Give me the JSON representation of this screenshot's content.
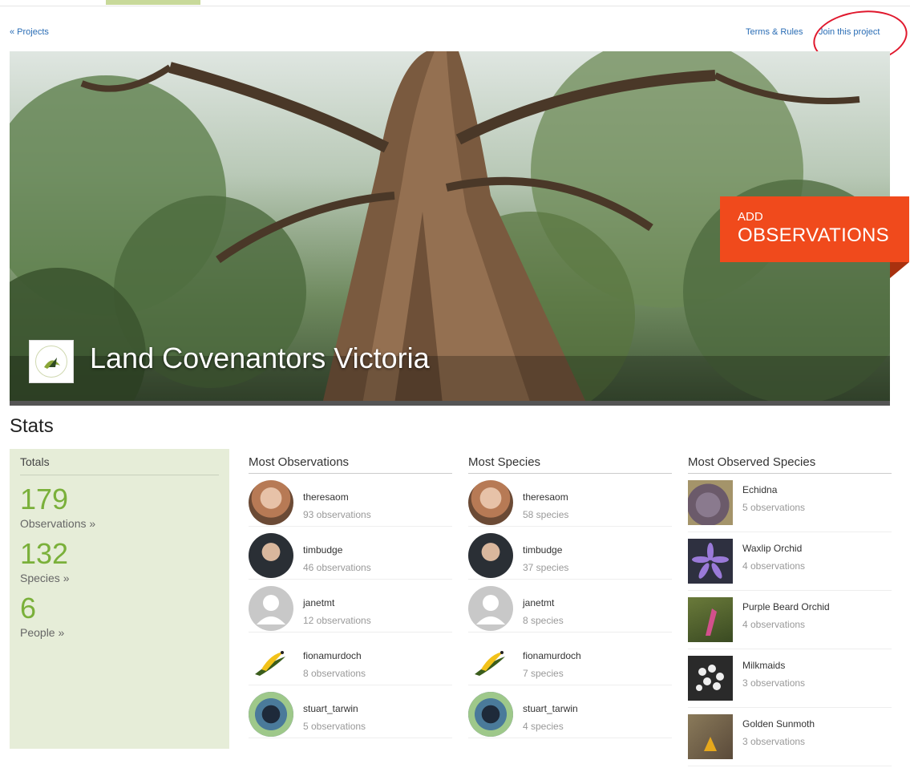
{
  "nav": {
    "back_link": "« Projects",
    "terms_link": "Terms & Rules",
    "join_link": "Join this project"
  },
  "hero": {
    "title": "Land Covenantors Victoria",
    "add_observations": {
      "line1": "ADD",
      "line2": "OBSERVATIONS"
    }
  },
  "stats": {
    "heading": "Stats",
    "totals": {
      "header": "Totals",
      "items": [
        {
          "value": "179",
          "label": "Observations »"
        },
        {
          "value": "132",
          "label": "Species »"
        },
        {
          "value": "6",
          "label": "People »"
        }
      ]
    },
    "most_observations": {
      "header": "Most Observations",
      "rows": [
        {
          "user": "theresaom",
          "meta": "93 observations",
          "avatar": "photo-woman"
        },
        {
          "user": "timbudge",
          "meta": "46 observations",
          "avatar": "photo-man"
        },
        {
          "user": "janetmt",
          "meta": "12 observations",
          "avatar": "default-user"
        },
        {
          "user": "fionamurdoch",
          "meta": "8 observations",
          "avatar": "bird"
        },
        {
          "user": "stuart_tarwin",
          "meta": "5 observations",
          "avatar": "circle-pattern"
        }
      ]
    },
    "most_species": {
      "header": "Most Species",
      "rows": [
        {
          "user": "theresaom",
          "meta": "58 species",
          "avatar": "photo-woman"
        },
        {
          "user": "timbudge",
          "meta": "37 species",
          "avatar": "photo-man"
        },
        {
          "user": "janetmt",
          "meta": "8 species",
          "avatar": "default-user"
        },
        {
          "user": "fionamurdoch",
          "meta": "7 species",
          "avatar": "bird"
        },
        {
          "user": "stuart_tarwin",
          "meta": "4 species",
          "avatar": "circle-pattern"
        }
      ]
    },
    "most_observed_species": {
      "header": "Most Observed Species",
      "rows": [
        {
          "name": "Echidna",
          "meta": "5 observations",
          "color": "#6b5a6a"
        },
        {
          "name": "Waxlip Orchid",
          "meta": "4 observations",
          "color": "#4a4a66"
        },
        {
          "name": "Purple Beard Orchid",
          "meta": "4 observations",
          "color": "#7a6a3a"
        },
        {
          "name": "Milkmaids",
          "meta": "3 observations",
          "color": "#3a3a3a"
        },
        {
          "name": "Golden Sunmoth",
          "meta": "3 observations",
          "color": "#7a6a4a"
        }
      ]
    }
  },
  "colors": {
    "accent_green": "#7ab03a",
    "totals_bg": "#e6edd8",
    "cta_orange": "#f04a1c",
    "link_blue": "#2a6db5"
  }
}
